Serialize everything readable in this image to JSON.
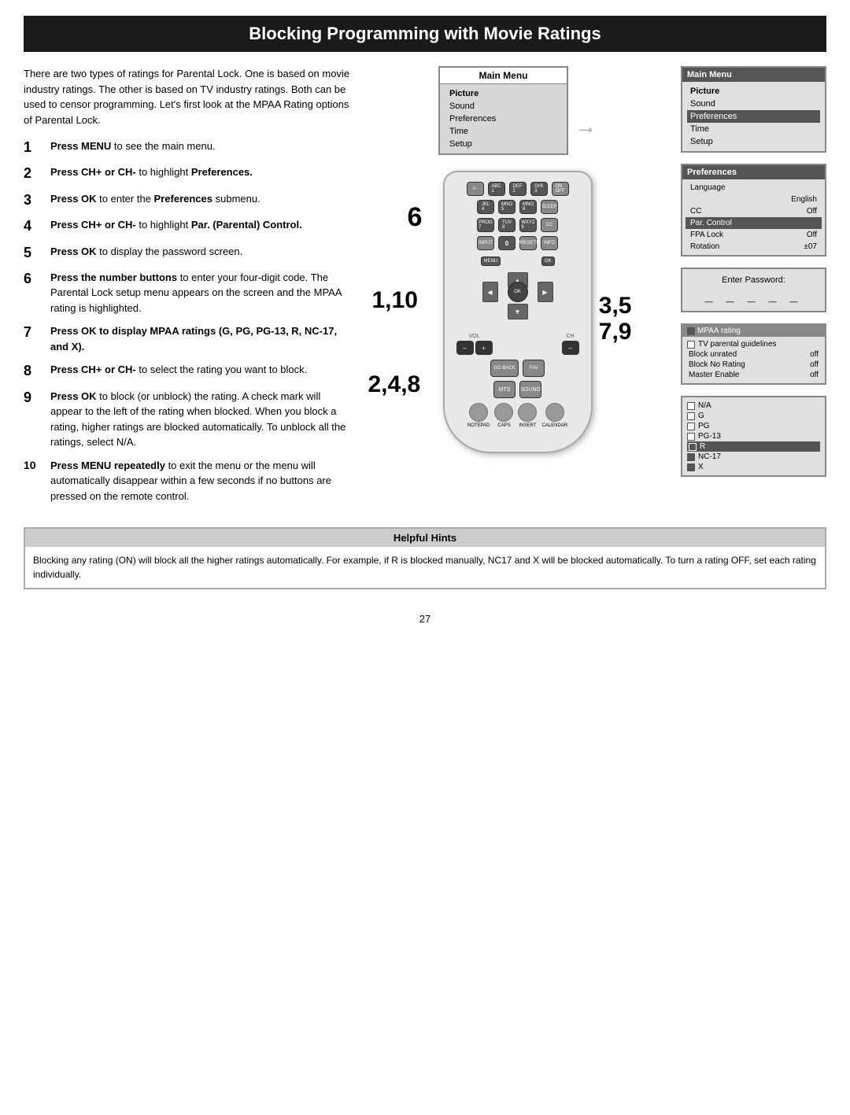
{
  "page": {
    "title": "Blocking Programming with Movie Ratings",
    "page_number": "27"
  },
  "intro": {
    "text": "There are two types of ratings for Parental Lock. One is based on movie industry ratings. The other is based on TV industry ratings. Both can be used to censor programming. Let's first look at the MPAA Rating options of Parental Lock."
  },
  "steps": [
    {
      "number": "1",
      "text": "Press MENU to see the main menu.",
      "bold_parts": [
        "MENU"
      ]
    },
    {
      "number": "2",
      "text": "Press CH+ or CH- to highlight Preferences.",
      "bold_parts": [
        "CH+",
        "CH-",
        "Preferences."
      ]
    },
    {
      "number": "3",
      "text": "Press OK to enter the Preferences submenu.",
      "bold_parts": [
        "OK",
        "Preferences"
      ]
    },
    {
      "number": "4",
      "text": "Press CH+ or CH- to highlight Par. (Parental) Control.",
      "bold_parts": [
        "CH+",
        "CH-",
        "Par.",
        "(Parental) Control."
      ]
    },
    {
      "number": "5",
      "text": "Press OK to display the password screen.",
      "bold_parts": [
        "OK"
      ]
    },
    {
      "number": "6",
      "text": "Press the number buttons to enter your four-digit code. The Parental Lock setup menu appears on the screen and the MPAA rating is highlighted.",
      "bold_parts": [
        "Press the number buttons"
      ]
    },
    {
      "number": "7",
      "text": "Press OK to display MPAA ratings (G, PG, PG-13, R, NC-17, and X).",
      "bold_parts": [
        "Press OK to display MPAA ratings (G, PG, PG-13, R, NC-17, and X)."
      ]
    },
    {
      "number": "8",
      "text": "Press CH+ or CH- to select the rating you want to block.",
      "bold_parts": [
        "CH+",
        "CH-"
      ]
    },
    {
      "number": "9",
      "text": "Press OK to block (or unblock) the rating. A check mark will appear to the left of the rating when blocked. When you block a rating, higher ratings are blocked automatically. To unblock all the ratings, select N/A.",
      "bold_parts": [
        "OK"
      ]
    },
    {
      "number": "10",
      "text": "Press MENU repeatedly to exit the menu or the menu will automatically disappear within a few seconds if no buttons are pressed on the remote control.",
      "bold_parts": [
        "Press MENU repeatedly"
      ]
    }
  ],
  "step_labels": {
    "label_6": "6",
    "label_110": "1,10",
    "label_35_79": "3,5\n7,9",
    "label_248": "2,4,8"
  },
  "main_menu_screen1": {
    "title": "Main Menu",
    "items": [
      "Picture",
      "Sound",
      "Preferences",
      "Time",
      "Setup"
    ]
  },
  "main_menu_screen2": {
    "title": "Main Menu",
    "items": [
      "Picture",
      "Sound",
      "Preferences",
      "Time",
      "Setup"
    ],
    "highlighted": "Preferences"
  },
  "preferences_screen": {
    "title": "Preferences",
    "rows": [
      {
        "label": "Language",
        "value": ""
      },
      {
        "label": "",
        "value": "English"
      },
      {
        "label": "CC",
        "value": "Off"
      },
      {
        "label": "Par. Control",
        "value": ""
      },
      {
        "label": "FPA Lock",
        "value": "Off"
      },
      {
        "label": "Rotation",
        "value": "±07"
      }
    ]
  },
  "password_screen": {
    "label": "Enter Password:",
    "dashes": "_ _ _ _ _"
  },
  "mpaa_screen": {
    "items": [
      {
        "label": "MPAA rating",
        "checked": false,
        "highlighted": true
      },
      {
        "label": "TV parental guidelines",
        "checked": false
      },
      {
        "label": "Block unrated",
        "value": "off"
      },
      {
        "label": "Block No Rating",
        "value": "off"
      },
      {
        "label": "Master Enable",
        "value": "off"
      }
    ]
  },
  "ratings_screen": {
    "items": [
      {
        "label": "N/A",
        "checked": false
      },
      {
        "label": "G",
        "checked": false
      },
      {
        "label": "PG",
        "checked": false
      },
      {
        "label": "PG-13",
        "checked": false
      },
      {
        "label": "R",
        "checked": true,
        "highlighted": true
      },
      {
        "label": "NC-17",
        "checked": true
      },
      {
        "label": "X",
        "checked": true
      }
    ]
  },
  "helpful_hints": {
    "title": "Helpful Hints",
    "text": "Blocking any rating (ON) will block all the higher ratings automatically. For example, if R is blocked manually, NC17 and X will be blocked automatically. To turn a rating OFF, set each rating individually."
  },
  "remote": {
    "buttons": {
      "row1": [
        "-/--",
        "ABC\n1",
        "DEF\n2",
        "GHI\n3",
        "ON·OFF"
      ],
      "row2": [
        "GKL\n4",
        "MNO\n5",
        "MNO\n6",
        "SLEEP"
      ],
      "row3": [
        "PROG\n7",
        "WXYZ\n8",
        "9",
        "CC"
      ],
      "row4": [
        "INPUT",
        "PRESETS",
        "INFO/OUE"
      ],
      "dpad": [
        "OK"
      ],
      "vol": [
        "VOL-",
        "VOL+"
      ],
      "ch": [
        "CH-"
      ],
      "nav": [
        "MENU",
        "GO BACK",
        "FAV"
      ],
      "bottom": [
        "MTS",
        "SOUND"
      ],
      "last": [
        "NOTEPAD",
        "CAPS",
        "INSERT",
        "CALENDAR"
      ]
    }
  }
}
